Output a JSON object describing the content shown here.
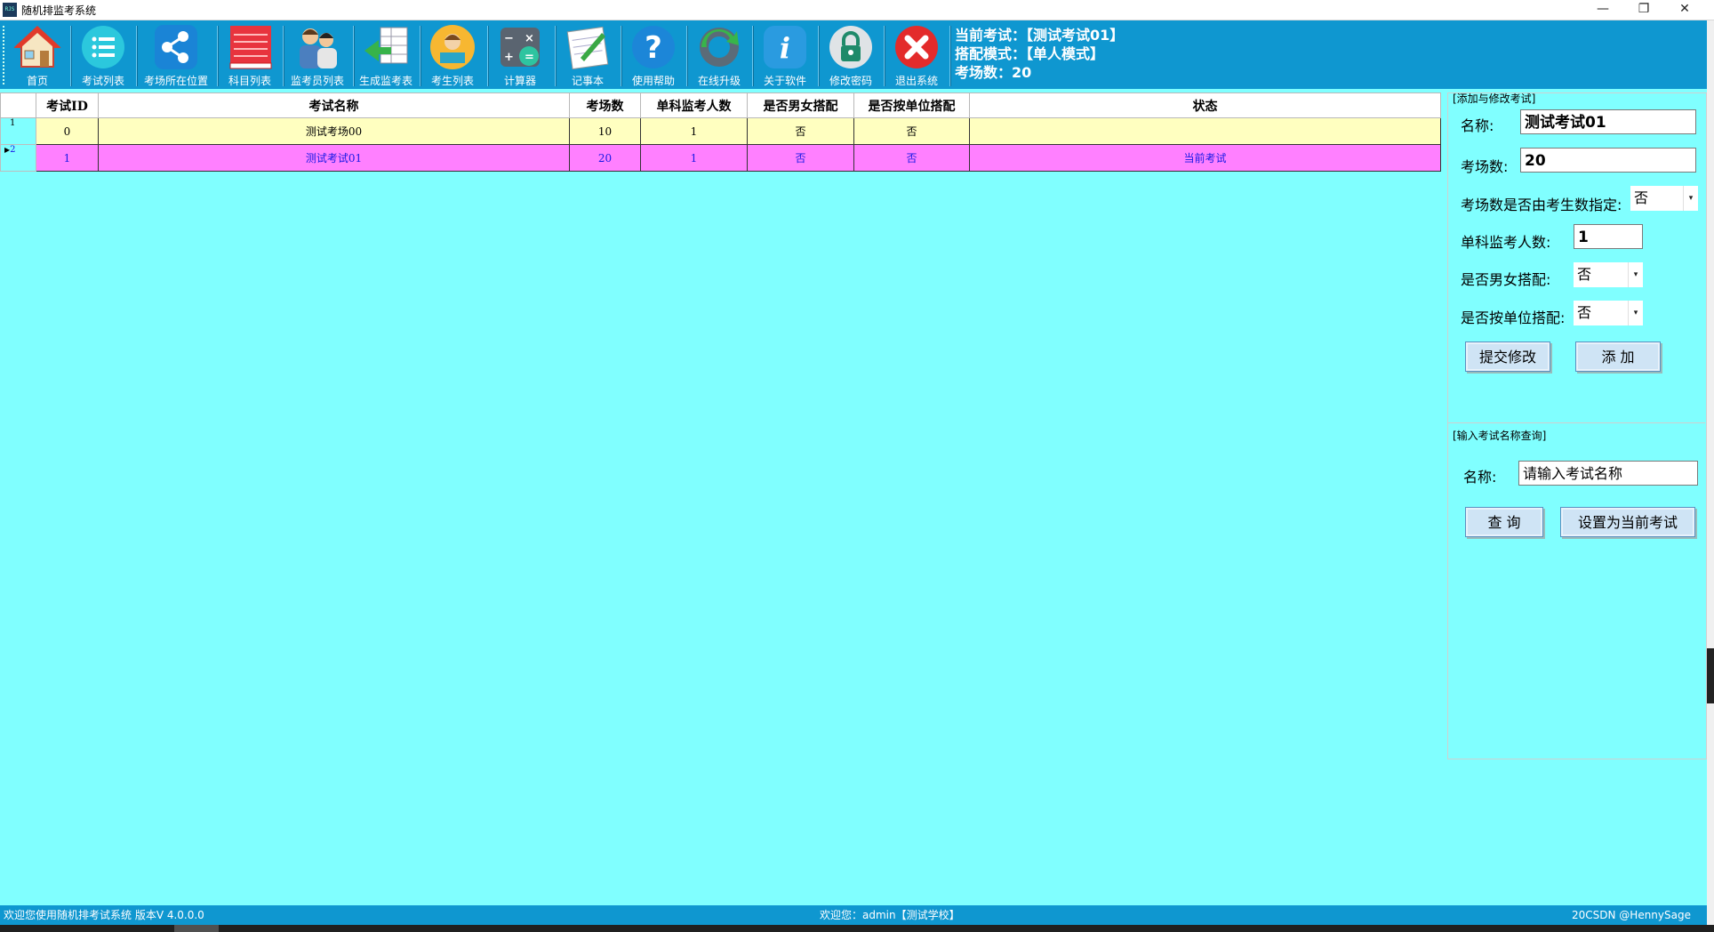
{
  "window": {
    "title": "随机排监考系统",
    "app_icon_text": "RJS",
    "minimize": "—",
    "restore": "❐",
    "close": "✕"
  },
  "toolbar": {
    "items": [
      {
        "label": "首页",
        "icon": "home-icon"
      },
      {
        "label": "考试列表",
        "icon": "list-icon"
      },
      {
        "label": "考场所在位置",
        "icon": "share-icon"
      },
      {
        "label": "科目列表",
        "icon": "book-icon"
      },
      {
        "label": "监考员列表",
        "icon": "people-icon"
      },
      {
        "label": "生成监考表",
        "icon": "generate-table-icon"
      },
      {
        "label": "考生列表",
        "icon": "student-icon"
      },
      {
        "label": "计算器",
        "icon": "calculator-icon"
      },
      {
        "label": "记事本",
        "icon": "notepad-icon"
      },
      {
        "label": "使用帮助",
        "icon": "help-icon"
      },
      {
        "label": "在线升级",
        "icon": "update-gear-icon"
      },
      {
        "label": "关于软件",
        "icon": "info-icon"
      },
      {
        "label": "修改密码",
        "icon": "lock-icon"
      },
      {
        "label": "退出系统",
        "icon": "exit-icon"
      }
    ],
    "info": {
      "current_exam_label": "当前考试：",
      "current_exam_value": "【测试考试01】",
      "mode_label": "搭配模式：",
      "mode_value": "【单人模式】",
      "room_count_label": "考场数：",
      "room_count_value": "20"
    }
  },
  "grid": {
    "columns": [
      "考试ID",
      "考试名称",
      "考场数",
      "单科监考人数",
      "是否男女搭配",
      "是否按单位搭配",
      "状态"
    ],
    "rows": [
      {
        "row_no": "1",
        "id": "0",
        "name": "测试考场00",
        "rooms": "10",
        "proctors": "1",
        "gender_mix": "否",
        "unit_mix": "否",
        "status": ""
      },
      {
        "row_no": "2",
        "id": "1",
        "name": "测试考试01",
        "rooms": "20",
        "proctors": "1",
        "gender_mix": "否",
        "unit_mix": "否",
        "status": "当前考试"
      }
    ]
  },
  "edit_panel": {
    "group_title": "[添加与修改考试]",
    "name_label": "名称:",
    "name_value": "测试考试01",
    "rooms_label": "考场数:",
    "rooms_value": "20",
    "rooms_by_students_label": "考场数是否由考生数指定:",
    "rooms_by_students_value": "否",
    "proctors_label": "单科监考人数:",
    "proctors_value": "1",
    "gender_mix_label": "是否男女搭配:",
    "gender_mix_value": "否",
    "unit_mix_label": "是否按单位搭配:",
    "unit_mix_value": "否",
    "submit_button": "提交修改",
    "add_button": "添 加"
  },
  "query_panel": {
    "group_title": "[输入考试名称查询]",
    "name_label": "名称:",
    "name_placeholder": "请输入考试名称",
    "query_button": "查 询",
    "set_current_button": "设置为当前考试"
  },
  "status_bar": {
    "welcome": "欢迎您使用随机排考试系统  版本V 4.0.0.0",
    "user": "欢迎您：admin【测试学校】",
    "right": "20CSDN @HennySage"
  },
  "colors": {
    "background": "#80ffff",
    "toolbar": "#0f97d0",
    "row_normal": "#ffffc0",
    "row_current": "#ff80ff"
  }
}
